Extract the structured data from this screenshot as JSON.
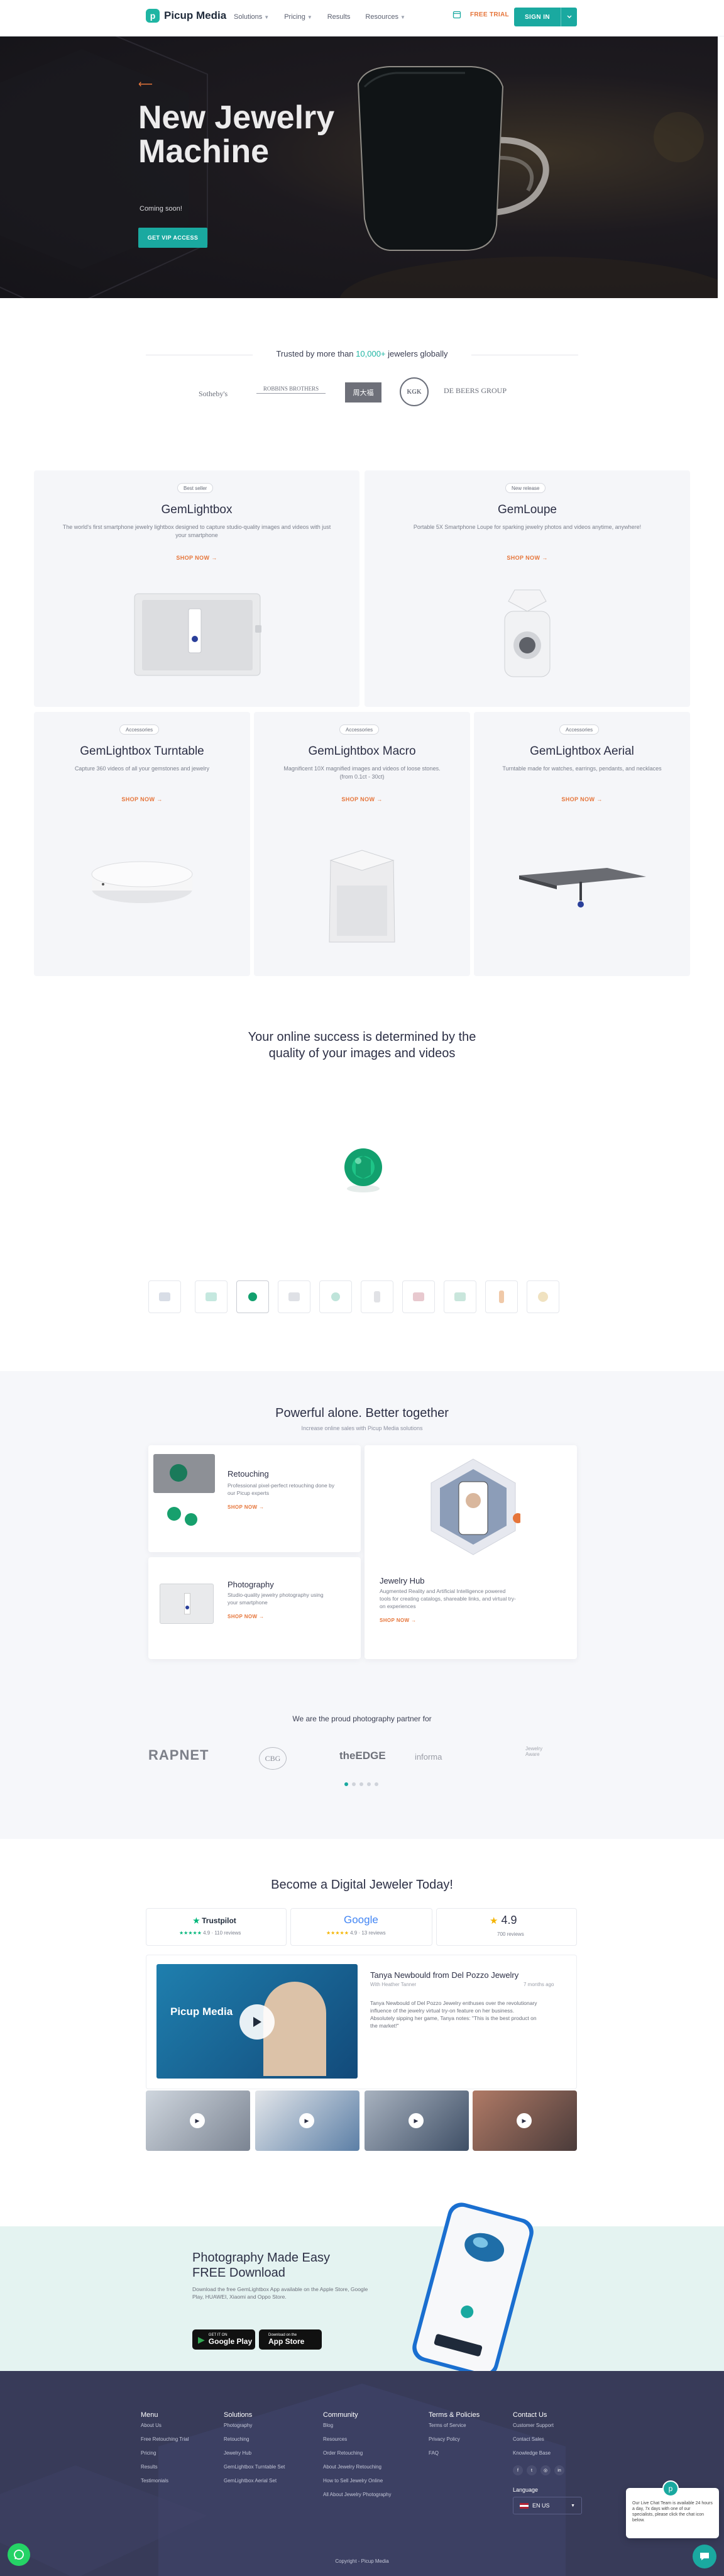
{
  "nav": {
    "logo": "Picup Media",
    "links": [
      "Solutions",
      "Pricing",
      "Results",
      "Resources"
    ],
    "trial": "FREE TRIAL",
    "signin": "SIGN IN"
  },
  "hero": {
    "title": "New Jewelry Machine",
    "subtitle": "Coming soon!",
    "cta": "GET VIP ACCESS"
  },
  "trusted": {
    "prefix": "Trusted by more than",
    "count": "10,000+",
    "suffix": "jewelers globally",
    "brands": [
      "Sotheby's",
      "ROBBINS BROTHERS",
      "周大福",
      "KGK",
      "DE BEERS GROUP"
    ]
  },
  "products": {
    "shop_label": "SHOP NOW",
    "items": [
      {
        "badge": "Best seller",
        "title": "GemLightbox",
        "desc": "The world's first smartphone jewelry lightbox designed to capture studio-quality images and videos with just your smartphone"
      },
      {
        "badge": "New release",
        "title": "GemLoupe",
        "desc": "Portable 5X Smartphone Loupe for sparking jewelry photos and videos anytime, anywhere!"
      },
      {
        "badge": "Accessories",
        "title": "GemLightbox Turntable",
        "desc": "Capture 360 videos of all your gemstones and jewelry"
      },
      {
        "badge": "Accessories",
        "title": "GemLightbox Macro",
        "desc": "Magnificent 10X magnified images and videos of loose stones. (from 0.1ct - 30ct)"
      },
      {
        "badge": "Accessories",
        "title": "GemLightbox Aerial",
        "desc": "Turntable made for watches, earrings, pendants, and necklaces"
      }
    ]
  },
  "success": {
    "title": "Your online success is determined by the quality of your images and videos"
  },
  "together": {
    "title": "Powerful alone. Better together",
    "subtitle": "Increase online sales with Picup Media solutions",
    "cards": [
      {
        "title": "Retouching",
        "desc": "Professional pixel-perfect retouching done by our Picup experts",
        "cta": "SHOP NOW"
      },
      {
        "title": "Jewelry Hub",
        "desc": "Augmented Reality and Artificial Intelligence powered tools for creating catalogs, shareable links, and virtual try-on experiences",
        "cta": "SHOP NOW"
      },
      {
        "title": "Photography",
        "desc": "Studio-quality jewelry photography using your smartphone",
        "cta": "SHOP NOW"
      }
    ]
  },
  "partners": {
    "title": "We are the proud photography partner for",
    "logos": [
      "RAPNET",
      "CBG",
      "theEDGE",
      "informa",
      "Jewelry Aware"
    ]
  },
  "digital": {
    "title": "Become a Digital Jeweler Today!",
    "trustpilot": {
      "name": "Trustpilot",
      "rating": "4.9",
      "reviews": "110 reviews"
    },
    "google": {
      "name": "Google",
      "rating": "4.9",
      "reviews": "13 reviews"
    },
    "overall": {
      "rating": "4.9",
      "reviews": "700 reviews"
    },
    "review": {
      "title": "Tanya Newbould from Del Pozzo Jewelry",
      "author": "With Heather Tanner",
      "time": "7 months ago",
      "text": "Tanya Newbould of Del Pozzo Jewelry enthuses over the revolutionary influence of the jewelry virtual try-on feature on her business. Absolutely sipping her game, Tanya notes: \"This is the best product on the market!\""
    },
    "video_brand": "Picup Media"
  },
  "app": {
    "title_line1": "Photography Made Easy",
    "title_line2": "FREE Download",
    "desc": "Download the free GemLightbox App available on the Apple Store, Google Play, HUAWEI, Xiaomi and Oppo Store.",
    "gp_small": "GET IT ON",
    "gp_large": "Google Play",
    "as_small": "Download on the",
    "as_large": "App Store"
  },
  "footer": {
    "menu": {
      "title": "Menu",
      "links": [
        "About Us",
        "Free Retouching Trial",
        "Pricing",
        "Results",
        "Testimonials"
      ]
    },
    "solutions": {
      "title": "Solutions",
      "links": [
        "Photography",
        "Retouching",
        "Jewelry Hub",
        "GemLightbox Turntable Set",
        "GemLightbox Aerial Set"
      ]
    },
    "community": {
      "title": "Community",
      "links": [
        "Blog",
        "Resources",
        "Order Retouching",
        "About Jewelry Retouching",
        "How to Sell Jewelry Online",
        "All About Jewelry Photography"
      ]
    },
    "terms": {
      "title": "Terms & Policies",
      "links": [
        "Terms of Service",
        "Privacy Policy",
        "FAQ"
      ]
    },
    "contact": {
      "title": "Contact Us",
      "links": [
        "Customer Support",
        "Contact Sales",
        "Knowledge Base"
      ]
    },
    "language_label": "Language",
    "language": "EN US",
    "copyright": "Copyright - Picup Media"
  },
  "chat": {
    "text": "Our Live Chat Team is available 24 hours a day, 7x days with one of our specialists, please click the chat icon below."
  },
  "colors": {
    "accent": "#1aa9a0",
    "orange": "#e6753a",
    "footer": "#383b59"
  }
}
